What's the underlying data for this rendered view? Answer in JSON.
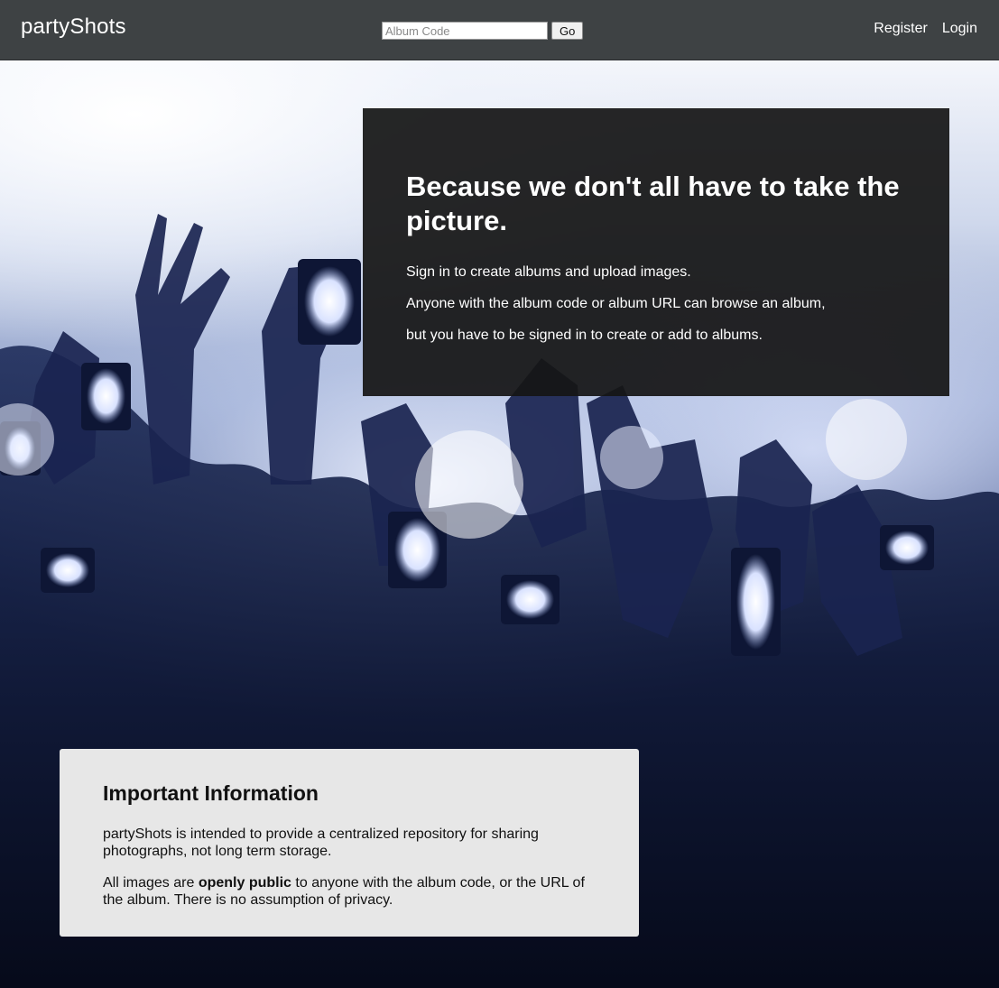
{
  "navbar": {
    "brand": "partyShots",
    "album_search": {
      "placeholder": "Album Code",
      "value": "",
      "button_label": "Go"
    },
    "links": [
      {
        "label": "Register"
      },
      {
        "label": "Login"
      }
    ]
  },
  "hero": {
    "background": "concert crowd holding up phones",
    "title": "Because we don't all have to take the picture.",
    "paragraphs": [
      "Sign in to create albums and upload images.",
      "Anyone with the album code or album URL can browse an album,",
      "but you have to be signed in to create or add to albums."
    ]
  },
  "important": {
    "title": "Important Information",
    "paragraph1": "partyShots is intended to provide a centralized repository for sharing photographs, not long term storage.",
    "paragraph2_prefix": "All images are ",
    "paragraph2_bold": "openly public",
    "paragraph2_suffix": " to anyone with the album code, or the URL of the album. There is no assumption of privacy."
  },
  "colors": {
    "navbar_bg": "#3e4244",
    "intro_box_bg": "#161616",
    "important_box_bg": "#e7e7e7"
  }
}
